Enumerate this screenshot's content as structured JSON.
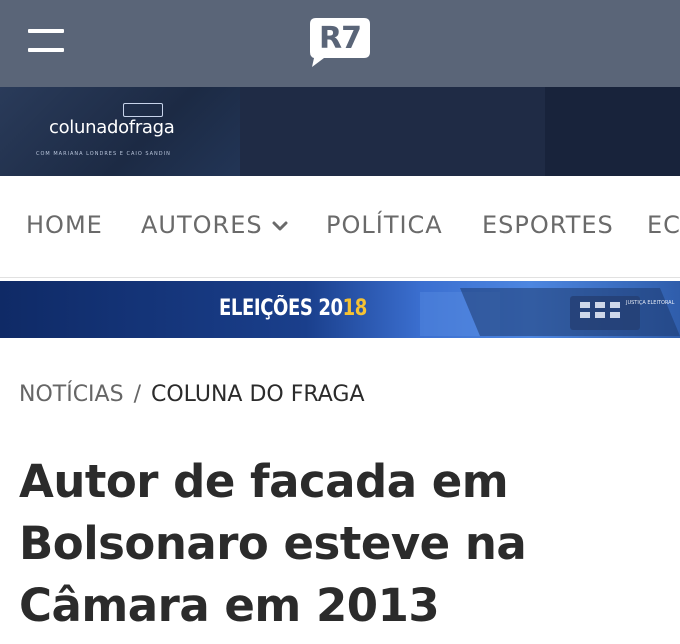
{
  "header": {
    "logo_text": "R7",
    "bar_color": "#5a6578"
  },
  "column": {
    "name": "colunadofraga",
    "subtitle": "COM MARIANA LONDRES E CAIO SANDIN"
  },
  "nav": {
    "items": [
      {
        "label": "HOME"
      },
      {
        "label": "AUTORES"
      },
      {
        "label": "POLÍTICA"
      },
      {
        "label": "ESPORTES"
      },
      {
        "label": "EC"
      }
    ]
  },
  "election_banner": {
    "text_main": "ELEIÇÕES 20",
    "text_accent": "18",
    "machine_label": "JUSTIÇA ELEITORAL",
    "accent_color": "#f5c233"
  },
  "breadcrumb": {
    "section": "NOTÍCIAS",
    "separator": "/",
    "current": "COLUNA DO FRAGA"
  },
  "article": {
    "headline_lines": [
      "Autor de facada em",
      "Bolsonaro esteve na",
      "Câmara em 2013"
    ]
  }
}
